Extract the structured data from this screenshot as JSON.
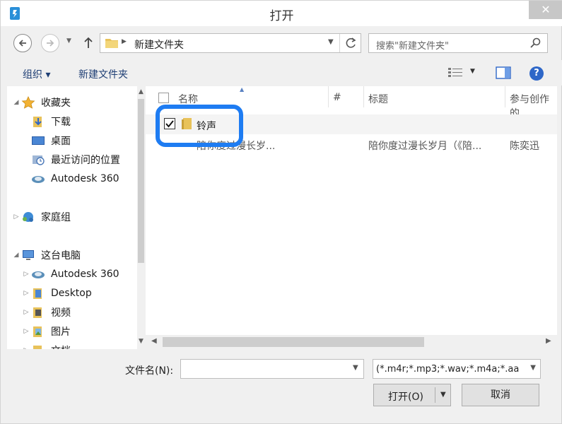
{
  "window": {
    "title": "打开",
    "close_label": "✕"
  },
  "address": {
    "path_segment": "新建文件夹"
  },
  "search": {
    "placeholder": "搜索\"新建文件夹\""
  },
  "toolbar": {
    "organize_label": "组织 ▾",
    "new_folder_label": "新建文件夹"
  },
  "sidebar": {
    "favorites_label": "收藏夹",
    "downloads_label": "下载",
    "desktop_label": "桌面",
    "recent_label": "最近访问的位置",
    "autodesk_label": "Autodesk 360",
    "homegroup_label": "家庭组",
    "thispc_label": "这台电脑",
    "pc_autodesk_label": "Autodesk 360",
    "pc_desktop_label": "Desktop",
    "videos_label": "视频",
    "pictures_label": "图片",
    "documents_label": "文档"
  },
  "filelist": {
    "columns": {
      "name": "名称",
      "number": "#",
      "title": "标题",
      "artists": "参与创作的"
    },
    "folder": {
      "name": "铃声",
      "checked": true
    },
    "file": {
      "name": "陪你度过漫长岁...",
      "title": "陪你度过漫长岁月（《陪...",
      "artist": "陈奕迅"
    }
  },
  "bottom": {
    "filename_label": "文件名(N):",
    "filename_value": "",
    "filter_value": "(*.m4r;*.mp3;*.wav;*.m4a;*.aa",
    "open_label": "打开(O)",
    "cancel_label": "取消"
  },
  "colors": {
    "highlight": "#1e7cf2",
    "help": "#2e67c8",
    "link": "#1e3e74"
  }
}
